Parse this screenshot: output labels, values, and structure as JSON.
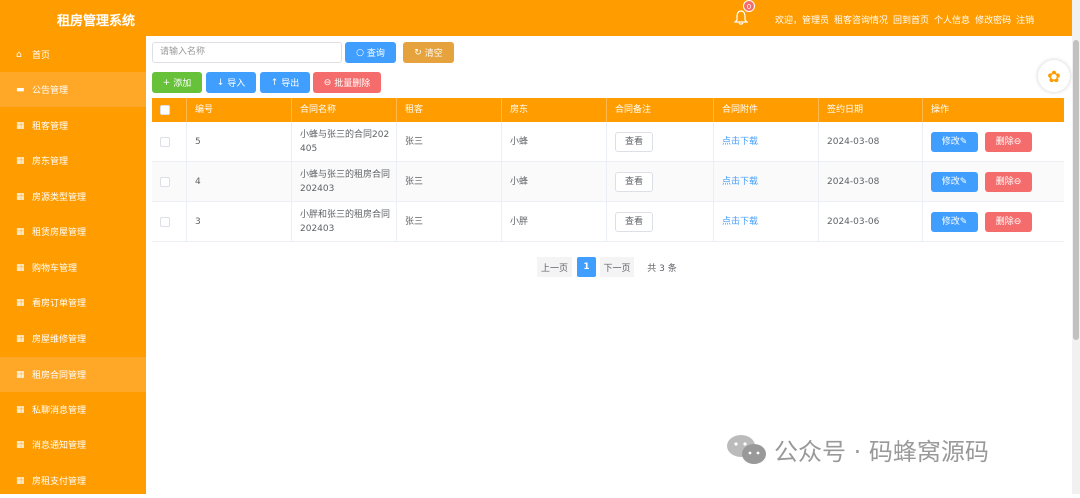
{
  "app": {
    "title": "租房管理系统"
  },
  "header": {
    "badge": "0",
    "links": [
      "欢迎，管理员",
      "租客咨询情况",
      "回到首页",
      "个人信息",
      "修改密码",
      "注销"
    ]
  },
  "sidebar": {
    "items": [
      {
        "icon": "⌂",
        "label": "首页"
      },
      {
        "icon": "▬",
        "label": "公告管理"
      },
      {
        "icon": "▦",
        "label": "租客管理"
      },
      {
        "icon": "▦",
        "label": "房东管理"
      },
      {
        "icon": "▦",
        "label": "房源类型管理"
      },
      {
        "icon": "▦",
        "label": "租赁房屋管理"
      },
      {
        "icon": "▦",
        "label": "购物车管理"
      },
      {
        "icon": "▦",
        "label": "看房订单管理"
      },
      {
        "icon": "▦",
        "label": "房屋维修管理"
      },
      {
        "icon": "▦",
        "label": "租房合同管理"
      },
      {
        "icon": "▦",
        "label": "私聊消息管理"
      },
      {
        "icon": "▦",
        "label": "消息通知管理"
      },
      {
        "icon": "▦",
        "label": "房租支付管理"
      }
    ]
  },
  "search": {
    "placeholder": "请输入名称",
    "query_label": "查询",
    "reset_label": "清空"
  },
  "toolbar": {
    "add_label": "添加",
    "import_label": "导入",
    "export_label": "导出",
    "batch_delete_label": "批量删除"
  },
  "table": {
    "headers": [
      "编号",
      "合同名称",
      "租客",
      "房东",
      "合同备注",
      "合同附件",
      "签约日期",
      "操作"
    ],
    "rows": [
      {
        "id": "5",
        "name_l1": "小蜂与张三的合同202",
        "name_l2": "405",
        "tenant": "张三",
        "landlord": "小蜂",
        "note_btn": "查看",
        "attach": "点击下载",
        "date": "2024-03-08"
      },
      {
        "id": "4",
        "name_l1": "小蜂与张三的租房合同",
        "name_l2": "202403",
        "tenant": "张三",
        "landlord": "小蜂",
        "note_btn": "查看",
        "attach": "点击下载",
        "date": "2024-03-08"
      },
      {
        "id": "3",
        "name_l1": "小胖和张三的租房合同",
        "name_l2": "202403",
        "tenant": "张三",
        "landlord": "小胖",
        "note_btn": "查看",
        "attach": "点击下载",
        "date": "2024-03-06"
      }
    ],
    "edit_label": "修改",
    "delete_label": "删除"
  },
  "pagination": {
    "prev": "上一页",
    "page": "1",
    "next": "下一页",
    "total": "共 3 条"
  },
  "watermark": {
    "text": "公众号 · 码蜂窝源码"
  }
}
